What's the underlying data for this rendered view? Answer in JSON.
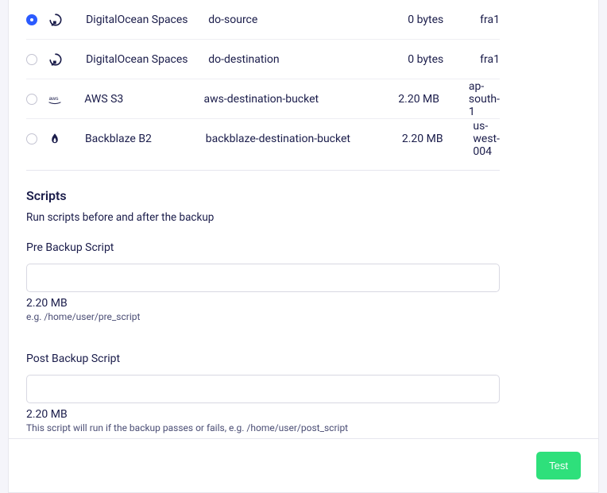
{
  "buckets": [
    {
      "provider": "DigitalOcean Spaces",
      "name": "do-source",
      "size": "0 bytes",
      "region": "fra1",
      "icon": "digitalocean",
      "selected": true
    },
    {
      "provider": "DigitalOcean Spaces",
      "name": "do-destination",
      "size": "0 bytes",
      "region": "fra1",
      "icon": "digitalocean",
      "selected": false
    },
    {
      "provider": "AWS S3",
      "name": "aws-destination-bucket",
      "size": "2.20 MB",
      "region": "ap-south-1",
      "icon": "aws",
      "selected": false
    },
    {
      "provider": "Backblaze B2",
      "name": "backblaze-destination-bucket",
      "size": "2.20 MB",
      "region": "us-west-004",
      "icon": "backblaze",
      "selected": false
    }
  ],
  "scripts": {
    "title": "Scripts",
    "subtitle": "Run scripts before and after the backup",
    "pre": {
      "label": "Pre Backup Script",
      "value": "",
      "size_under": "2.20 MB",
      "hint": "e.g. /home/user/pre_script"
    },
    "post": {
      "label": "Post Backup Script",
      "value": "",
      "size_under": "2.20 MB",
      "hint": "This script will run if the backup passes or fails, e.g. /home/user/post_script"
    }
  },
  "footer": {
    "test_label": "Test"
  }
}
